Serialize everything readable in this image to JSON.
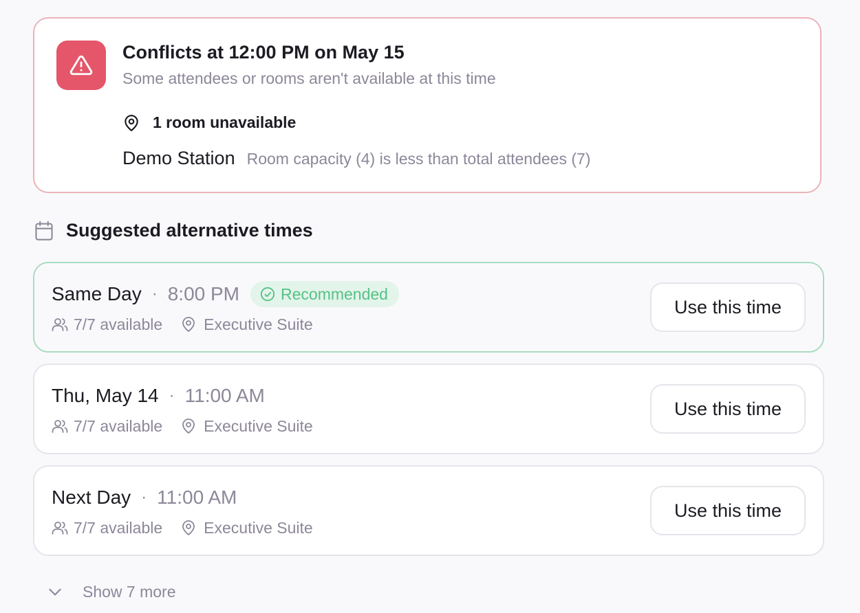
{
  "conflict": {
    "title": "Conflicts at 12:00 PM on May 15",
    "subtitle": "Some attendees or rooms aren't available at this time",
    "icon": "warning-icon",
    "accent_color": "#e5566a",
    "unavailable": {
      "icon": "map-pin-icon",
      "label": "1 room unavailable"
    },
    "rooms": [
      {
        "name": "Demo Station",
        "reason": "Room capacity (4) is less than total attendees (7)"
      }
    ]
  },
  "suggestions": {
    "icon": "calendar-icon",
    "title": "Suggested alternative times",
    "options": [
      {
        "day": "Same Day",
        "separator": "·",
        "time": "8:00 PM",
        "badge": "Recommended",
        "badge_icon": "check-circle-icon",
        "availability": "7/7 available",
        "location": "Executive Suite",
        "button": "Use this time"
      },
      {
        "day": "Thu, May 14",
        "separator": "·",
        "time": "11:00 AM",
        "availability": "7/7 available",
        "location": "Executive Suite",
        "button": "Use this time"
      },
      {
        "day": "Next Day",
        "separator": "·",
        "time": "11:00 AM",
        "availability": "7/7 available",
        "location": "Executive Suite",
        "button": "Use this time"
      }
    ],
    "show_more": {
      "icon": "chevron-down-icon",
      "label": "Show 7 more"
    }
  },
  "colors": {
    "danger": "#e5566a",
    "danger_border": "#ebb3b8",
    "success": "#55c186",
    "success_bg": "#e3f4ea",
    "success_border": "#a9dcc0",
    "muted_text": "#8d8799"
  }
}
